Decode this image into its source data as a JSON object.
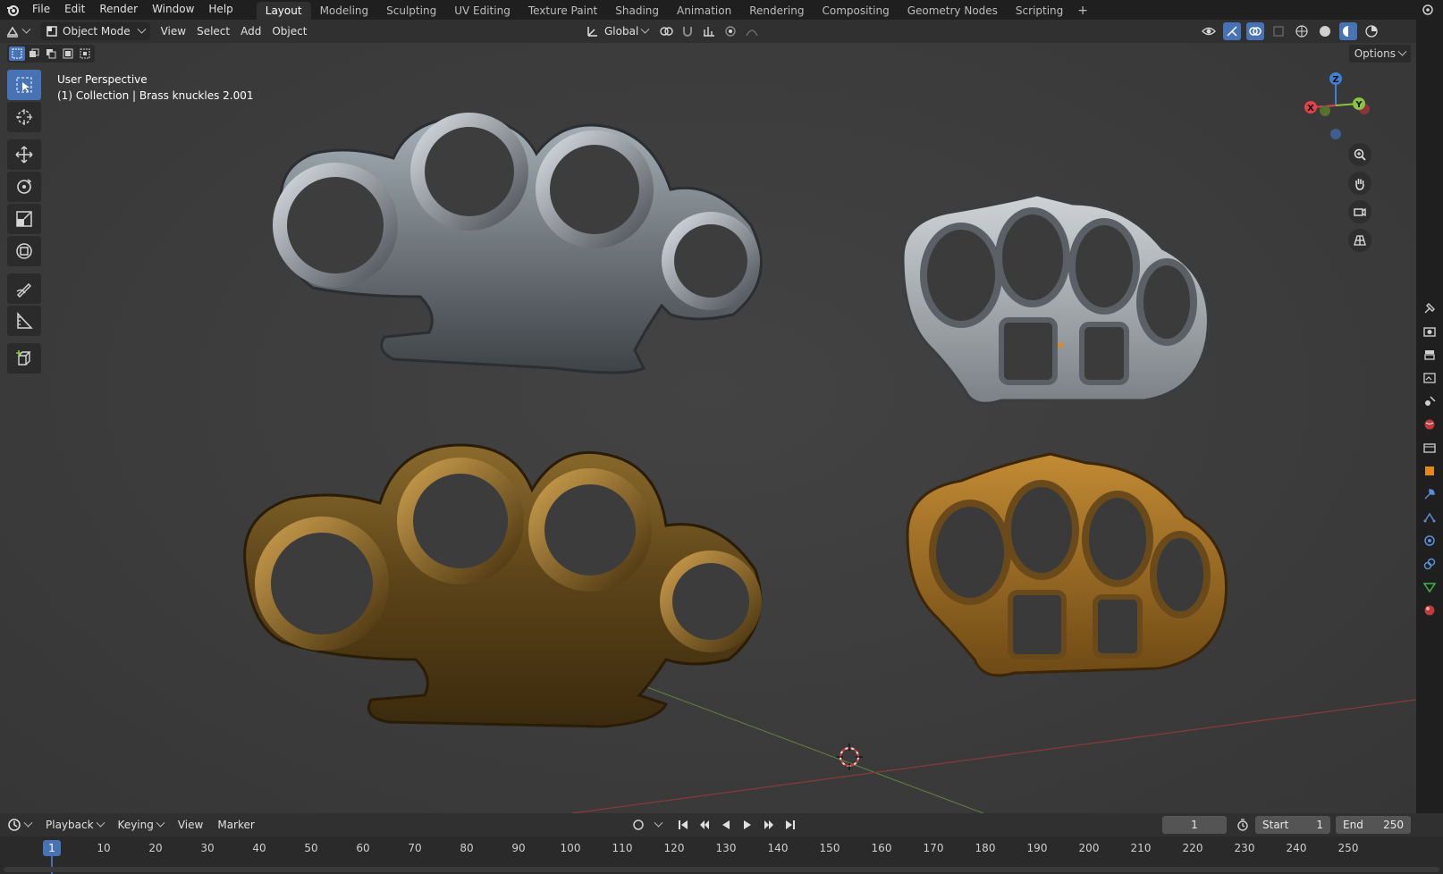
{
  "menubar": {
    "items": [
      "File",
      "Edit",
      "Render",
      "Window",
      "Help"
    ],
    "workspaces": [
      "Layout",
      "Modeling",
      "Sculpting",
      "UV Editing",
      "Texture Paint",
      "Shading",
      "Animation",
      "Rendering",
      "Compositing",
      "Geometry Nodes",
      "Scripting"
    ],
    "active_workspace": "Layout",
    "add_tab": "+"
  },
  "viewport_header": {
    "mode": "Object Mode",
    "menus": [
      "View",
      "Select",
      "Add",
      "Object"
    ],
    "transform_orientation": "Global"
  },
  "viewport": {
    "options_label": "Options",
    "perspective": "User Perspective",
    "collection_info": "(1) Collection | Brass knuckles 2.001",
    "gizmo_axes": {
      "x": "X",
      "y": "Y",
      "z": "Z"
    },
    "colors": {
      "x": "#e2434b",
      "y": "#8bc53f",
      "z": "#3e80d8",
      "accent": "#4772b3"
    },
    "objects": [
      "silver-knuckles-front",
      "silver-knuckles-angled",
      "brass-knuckles-front",
      "brass-knuckles-angled"
    ]
  },
  "timeline": {
    "menus": [
      "Playback",
      "Keying",
      "View",
      "Marker"
    ],
    "current_frame": "1",
    "start_label": "Start",
    "start_value": "1",
    "end_label": "End",
    "end_value": "250",
    "ruler_ticks": [
      "10",
      "20",
      "30",
      "40",
      "50",
      "60",
      "70",
      "80",
      "90",
      "100",
      "110",
      "120",
      "130",
      "140",
      "150",
      "160",
      "170",
      "180",
      "190",
      "200",
      "210",
      "220",
      "230",
      "240",
      "250"
    ]
  }
}
